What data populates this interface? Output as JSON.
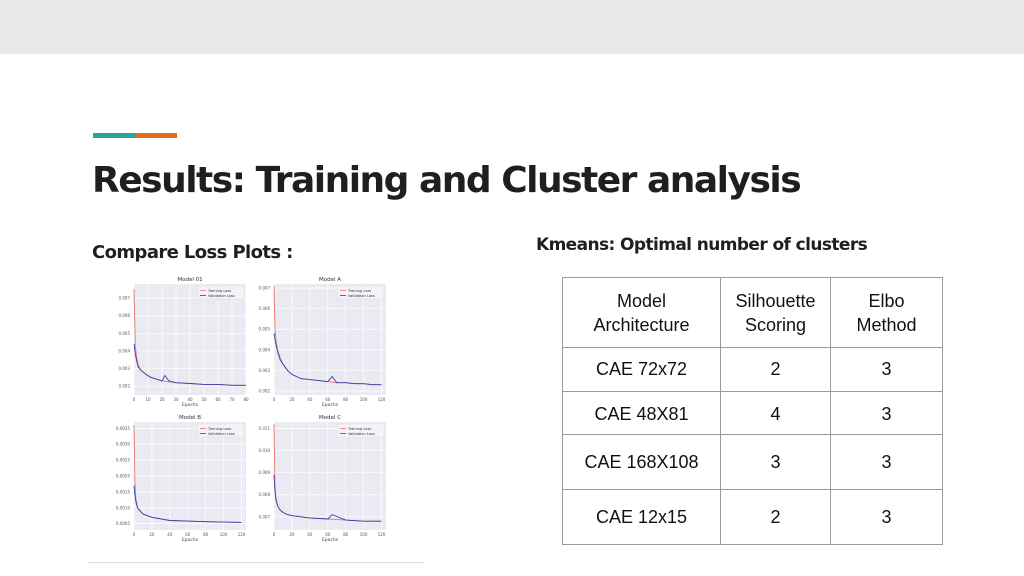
{
  "slide": {
    "title": "Results: Training and Cluster analysis",
    "left_heading": "Compare Loss Plots :",
    "right_heading": "Kmeans: Optimal number of clusters"
  },
  "table": {
    "headers": [
      {
        "line1": "Model",
        "line2": "Architecture"
      },
      {
        "line1": "Silhouette",
        "line2": "Scoring"
      },
      {
        "line1": "Elbo",
        "line2": "Method"
      }
    ],
    "rows": [
      [
        "CAE 72x72",
        "2",
        "3"
      ],
      [
        "CAE 48X81",
        "4",
        "3"
      ],
      [
        "CAE 168X108",
        "3",
        "3"
      ],
      [
        "CAE 12x15",
        "2",
        "3"
      ]
    ]
  },
  "chart_data": [
    {
      "type": "line",
      "title": "Model 01",
      "xlabel": "Epochs",
      "xticks": [
        "0",
        "10",
        "20",
        "30",
        "40",
        "50",
        "60",
        "70",
        "80"
      ],
      "yticks": [
        "0.002",
        "0.003",
        "0.004",
        "0.005",
        "0.006",
        "0.007"
      ],
      "xlim": [
        0,
        80
      ],
      "ylim": [
        0.0015,
        0.0078
      ],
      "legend": [
        "Training Loss",
        "Validation Loss"
      ],
      "legend_position": "top-right",
      "grid": true,
      "series": [
        {
          "name": "Training Loss",
          "x": [
            0,
            1,
            2,
            3,
            5,
            8,
            12,
            16,
            20,
            25,
            30,
            40,
            50,
            60,
            70,
            80
          ],
          "y": [
            0.0075,
            0.0042,
            0.0036,
            0.0032,
            0.0029,
            0.0027,
            0.0025,
            0.0024,
            0.0023,
            0.00225,
            0.0022,
            0.00215,
            0.0021,
            0.0021,
            0.00205,
            0.00205
          ]
        },
        {
          "name": "Validation Loss",
          "x": [
            0,
            1,
            2,
            3,
            5,
            8,
            12,
            16,
            20,
            22,
            25,
            30,
            40,
            50,
            60,
            70,
            80
          ],
          "y": [
            0.0044,
            0.0038,
            0.0034,
            0.0031,
            0.0029,
            0.0027,
            0.0025,
            0.0024,
            0.0023,
            0.0026,
            0.0023,
            0.0022,
            0.00215,
            0.0021,
            0.0021,
            0.00205,
            0.00205
          ]
        }
      ]
    },
    {
      "type": "line",
      "title": "Model A",
      "xlabel": "Epochs",
      "xticks": [
        "0",
        "20",
        "40",
        "60",
        "80",
        "100",
        "120"
      ],
      "yticks": [
        "0.002",
        "0.003",
        "0.004",
        "0.005",
        "0.006",
        "0.007"
      ],
      "xlim": [
        0,
        125
      ],
      "ylim": [
        0.0018,
        0.0072
      ],
      "legend": [
        "Training Loss",
        "Validation Loss"
      ],
      "legend_position": "top-right",
      "grid": true,
      "series": [
        {
          "name": "Training Loss",
          "x": [
            0,
            1,
            2,
            4,
            7,
            10,
            15,
            20,
            30,
            40,
            50,
            60,
            70,
            80,
            90,
            100,
            110,
            120
          ],
          "y": [
            0.0071,
            0.0052,
            0.0045,
            0.004,
            0.0036,
            0.0033,
            0.003,
            0.0028,
            0.0026,
            0.00255,
            0.0025,
            0.00245,
            0.0024,
            0.0024,
            0.00235,
            0.00235,
            0.0023,
            0.0023
          ]
        },
        {
          "name": "Validation Loss",
          "x": [
            0,
            2,
            4,
            7,
            10,
            15,
            20,
            30,
            40,
            50,
            60,
            65,
            70,
            80,
            90,
            100,
            110,
            120
          ],
          "y": [
            0.0048,
            0.0043,
            0.0039,
            0.0035,
            0.0033,
            0.003,
            0.0028,
            0.0026,
            0.00255,
            0.0025,
            0.00245,
            0.0027,
            0.0024,
            0.0024,
            0.00235,
            0.00235,
            0.0023,
            0.0023
          ]
        }
      ]
    },
    {
      "type": "line",
      "title": "Model B",
      "xlabel": "Epochs",
      "xticks": [
        "0",
        "20",
        "40",
        "60",
        "80",
        "100",
        "120"
      ],
      "yticks": [
        "0.0005",
        "0.0010",
        "0.0015",
        "0.0020",
        "0.0025",
        "0.0030",
        "0.0035"
      ],
      "xlim": [
        0,
        125
      ],
      "ylim": [
        0.0003,
        0.0037
      ],
      "legend": [
        "Training Loss",
        "Validation Loss"
      ],
      "legend_position": "top-right",
      "grid": true,
      "series": [
        {
          "name": "Training Loss",
          "x": [
            0,
            1,
            2,
            4,
            7,
            10,
            15,
            20,
            30,
            40,
            60,
            80,
            100,
            120
          ],
          "y": [
            0.0036,
            0.0018,
            0.0013,
            0.001,
            0.0009,
            0.0008,
            0.00075,
            0.0007,
            0.00065,
            0.0006,
            0.00058,
            0.00056,
            0.00055,
            0.00054
          ]
        },
        {
          "name": "Validation Loss",
          "x": [
            0,
            1,
            2,
            4,
            7,
            10,
            15,
            20,
            30,
            40,
            60,
            80,
            100,
            120
          ],
          "y": [
            0.0017,
            0.0014,
            0.0012,
            0.00098,
            0.0009,
            0.0008,
            0.00075,
            0.0007,
            0.00065,
            0.0006,
            0.00058,
            0.00056,
            0.00055,
            0.00054
          ]
        }
      ]
    },
    {
      "type": "line",
      "title": "Model C",
      "xlabel": "Epochs",
      "xticks": [
        "0",
        "20",
        "40",
        "60",
        "80",
        "100",
        "120"
      ],
      "yticks": [
        "0.007",
        "0.008",
        "0.009",
        "0.010",
        "0.011"
      ],
      "xlim": [
        0,
        125
      ],
      "ylim": [
        0.0064,
        0.0113
      ],
      "legend": [
        "Training Loss",
        "Validation Loss"
      ],
      "legend_position": "top-right",
      "grid": true,
      "series": [
        {
          "name": "Training Loss",
          "x": [
            0,
            1,
            2,
            4,
            7,
            10,
            15,
            20,
            30,
            40,
            60,
            80,
            100,
            120
          ],
          "y": [
            0.0112,
            0.0085,
            0.0079,
            0.0075,
            0.0073,
            0.0072,
            0.0071,
            0.00705,
            0.007,
            0.00695,
            0.0069,
            0.00685,
            0.0068,
            0.0068
          ]
        },
        {
          "name": "Validation Loss",
          "x": [
            0,
            1,
            2,
            4,
            7,
            10,
            15,
            20,
            30,
            40,
            60,
            65,
            80,
            100,
            120
          ],
          "y": [
            0.0089,
            0.0082,
            0.0078,
            0.0075,
            0.0073,
            0.0072,
            0.0071,
            0.00705,
            0.007,
            0.00695,
            0.0069,
            0.0071,
            0.00685,
            0.0068,
            0.0068
          ]
        }
      ]
    }
  ],
  "colors": {
    "accent_teal": "#2aa39a",
    "accent_orange": "#e36b1a",
    "training_line": "#e8766f",
    "validation_line": "#3b3fb0",
    "plot_bg": "#eaeaf2"
  }
}
